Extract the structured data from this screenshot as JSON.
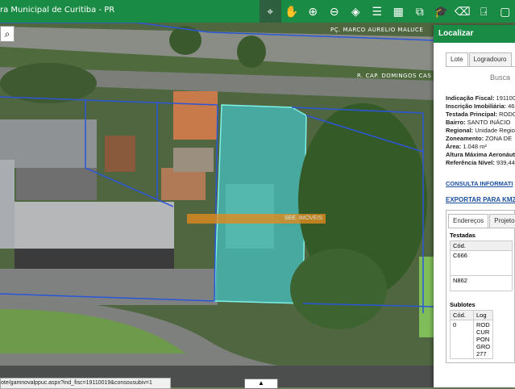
{
  "app": {
    "title": "ra Municipal de Curitiba - PR"
  },
  "toolbar": {
    "tools": [
      {
        "name": "identify-icon",
        "glyph": "⌖",
        "active": true
      },
      {
        "name": "pan-icon",
        "glyph": "✋",
        "active": false
      },
      {
        "name": "zoom-in-icon",
        "glyph": "⊕",
        "active": false
      },
      {
        "name": "zoom-out-icon",
        "glyph": "⊖",
        "active": false
      },
      {
        "name": "layers-icon",
        "glyph": "◈",
        "active": false
      },
      {
        "name": "list-icon",
        "glyph": "☰",
        "active": false
      },
      {
        "name": "grid-icon",
        "glyph": "▦",
        "active": false
      },
      {
        "name": "measure-icon",
        "glyph": "⧉",
        "active": false
      },
      {
        "name": "education-icon",
        "glyph": "🎓",
        "active": false
      },
      {
        "name": "eraser-icon",
        "glyph": "⌫",
        "active": false
      },
      {
        "name": "export-icon",
        "glyph": "⍈",
        "active": false
      },
      {
        "name": "frame-icon",
        "glyph": "▢",
        "active": false
      }
    ]
  },
  "map": {
    "streets": [
      {
        "name": "street-praca",
        "text": "PÇ. MARCO AURELIO MALUCE"
      },
      {
        "name": "street-domingos",
        "text": "R. CAP. DOMINGOS CAS"
      }
    ],
    "watermark": "SEE. IMÓVEIS",
    "zoom_glyph": "⌕"
  },
  "panel": {
    "title": "Localizar",
    "tabs": [
      "Lote",
      "Logradouro"
    ],
    "busca": "Busca",
    "fields": [
      {
        "label": "Indicação Fiscal:",
        "value": " 191100"
      },
      {
        "label": "Inscrição Imobiliária:",
        "value": " 46."
      },
      {
        "label": "Testada Principal:",
        "value": " RODO"
      },
      {
        "label": "Bairro:",
        "value": " SANTO INÁCIO"
      },
      {
        "label": "Regional:",
        "value": " Unidade Regio"
      },
      {
        "label": "Zoneamento:",
        "value": " ZONA DE"
      },
      {
        "label": "Área:",
        "value": " 1.048 m²"
      },
      {
        "label": "Altura Máxima Aeronáut",
        "value": ""
      },
      {
        "label": "Referência Nível:",
        "value": " 939,44"
      }
    ],
    "consulta": "CONSULTA INFORMATI",
    "kmz": "EXPORTAR PARA KMZ",
    "subtabs": [
      "Endereços",
      "Projeto"
    ],
    "testadas": {
      "title": "Testadas",
      "header": "Cód.",
      "rows": [
        "C666",
        "N862"
      ]
    },
    "sublotes": {
      "title": "Sublotes",
      "headers": [
        "Cód.",
        "Log"
      ],
      "row": {
        "cod": "0",
        "lines": [
          "ROD",
          "CUR",
          "PON",
          "GRO",
          "277"
        ]
      }
    }
  },
  "status": {
    "url": "ote/gamnovalppuc.aspx?ind_fisc=19110019&consousubiv=1"
  }
}
